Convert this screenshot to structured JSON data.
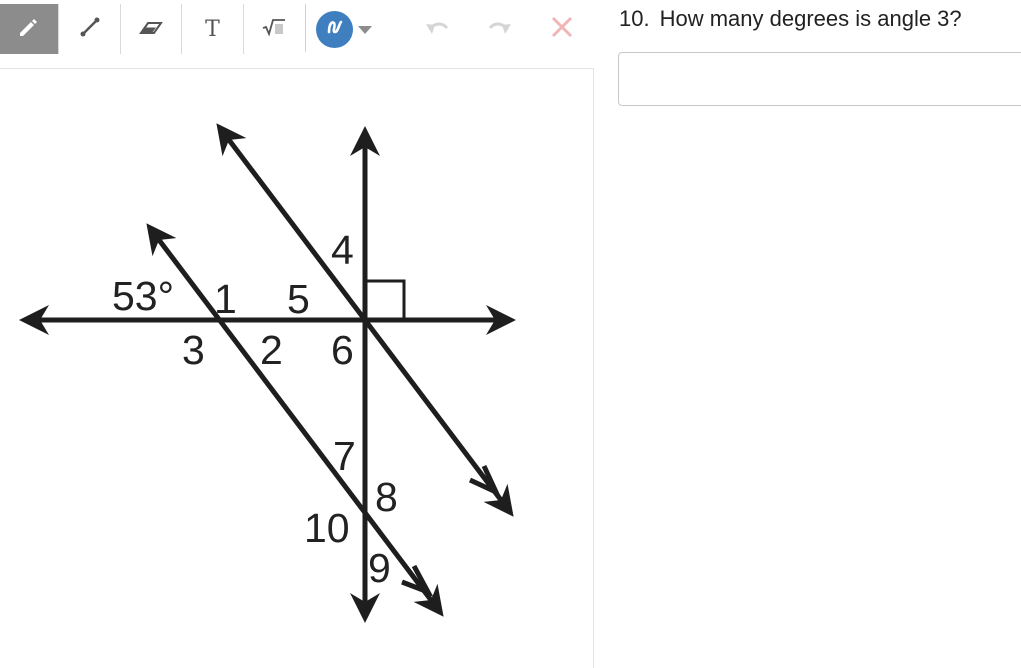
{
  "toolbar": {
    "tools": [
      {
        "name": "pencil-icon",
        "active": true
      },
      {
        "name": "line-icon",
        "active": false
      },
      {
        "name": "eraser-icon",
        "active": false
      },
      {
        "name": "text-icon",
        "glyph": "T",
        "active": false
      },
      {
        "name": "math-icon",
        "active": false
      }
    ],
    "color": "#3f7fbf",
    "undo_icon": "undo-icon",
    "redo_icon": "redo-icon",
    "clear_icon": "close-icon"
  },
  "question": {
    "number": "10.",
    "text": "How many degrees is angle 3?"
  },
  "answer": {
    "value": "",
    "placeholder": ""
  },
  "figure": {
    "given_angle": "53°",
    "labels": [
      "1",
      "2",
      "3",
      "4",
      "5",
      "6",
      "7",
      "8",
      "9",
      "10"
    ]
  }
}
